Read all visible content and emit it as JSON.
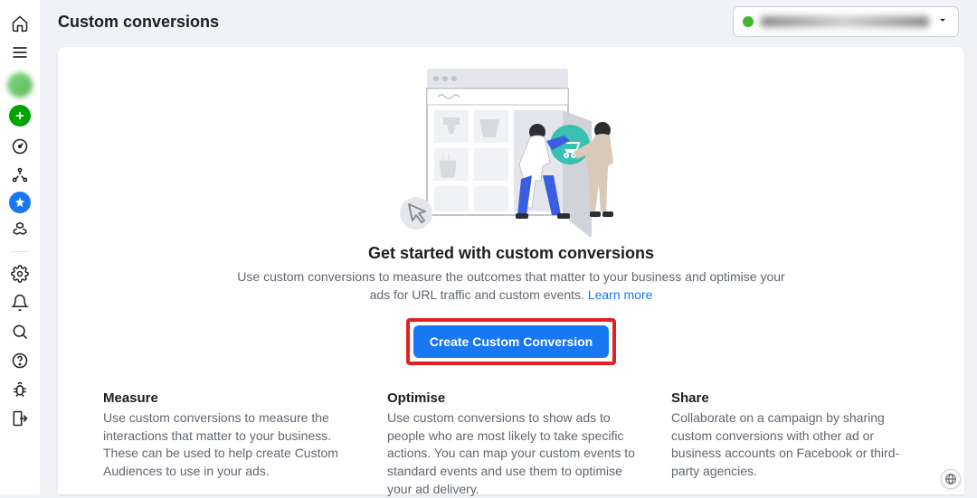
{
  "pageTitle": "Custom conversions",
  "accountSelector": {
    "label": "Account Name (123456)"
  },
  "hero": {
    "title": "Get started with custom conversions",
    "desc_prefix": "Use custom conversions to measure the outcomes that matter to your business and optimise your ads for URL traffic and custom events.",
    "learn_more": "Learn more",
    "cta": "Create Custom Conversion"
  },
  "columns": [
    {
      "title": "Measure",
      "desc": "Use custom conversions to measure the interactions that matter to your business. These can be used to help create Custom Audiences to use in your ads."
    },
    {
      "title": "Optimise",
      "desc": "Use custom conversions to show ads to people who are most likely to take specific actions. You can map your custom events to standard events and use them to optimise your ad delivery."
    },
    {
      "title": "Share",
      "desc": "Collaborate on a campaign by sharing custom conversions with other ad or business accounts on Facebook or third-party agencies."
    }
  ],
  "rail": {
    "home": "home-icon",
    "menu": "menu-icon",
    "avatar": "avatar",
    "plus": "plus-icon",
    "gauge": "gauge-icon",
    "events": "events-icon",
    "star": "star-icon",
    "partner": "partner-icon",
    "settings": "settings-icon",
    "bell": "bell-icon",
    "search": "search-icon",
    "help": "help-icon",
    "bug": "bug-icon",
    "exit": "exit-icon"
  }
}
